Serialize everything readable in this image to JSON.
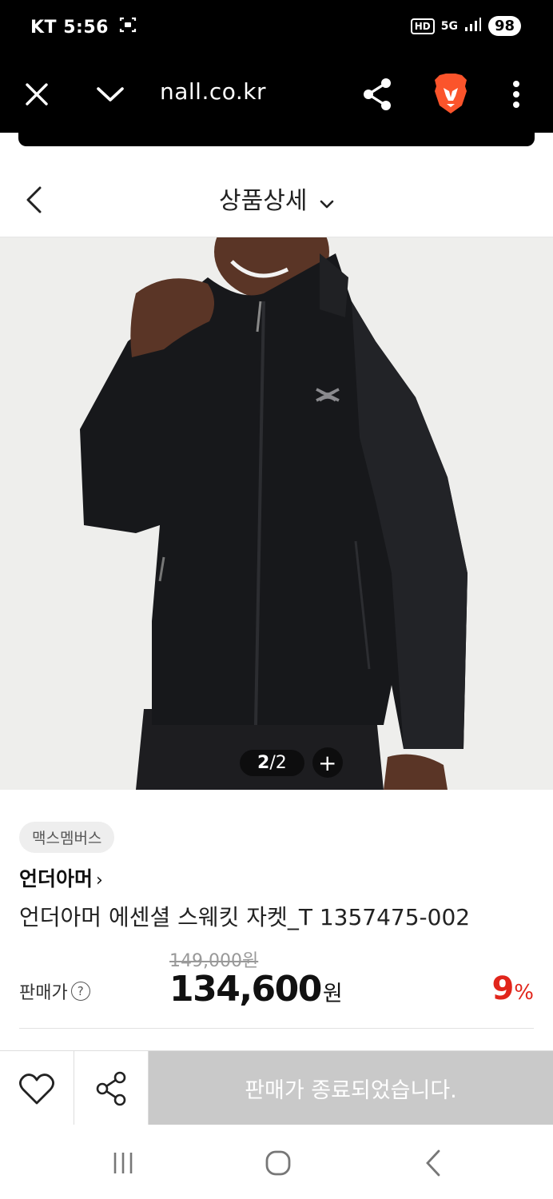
{
  "status": {
    "carrier_time": "KT 5:56",
    "hd": "HD",
    "network": "5G",
    "battery": "98"
  },
  "browser": {
    "url": "nall.co.kr"
  },
  "header": {
    "title": "상품상세"
  },
  "gallery": {
    "page_current": "2",
    "page_sep": "/",
    "page_total": "2",
    "expand": "+"
  },
  "product": {
    "tag": "맥스멤버스",
    "brand": "언더아머",
    "brand_arrow": "›",
    "name": "언더아머 에센셜 스웨킷 자켓_T 1357475-002",
    "original_price": "149,000원",
    "price_label": "판매가",
    "price_help": "?",
    "price": "134,600",
    "currency": "원",
    "discount": "9",
    "discount_unit": "%"
  },
  "actions": {
    "buy_label": "판매가 종료되었습니다."
  },
  "colors": {
    "discount": "#e1251b",
    "disabled_button": "#c9c9c9",
    "statusbar": "#000000",
    "brave_orange": "#fb542b"
  }
}
